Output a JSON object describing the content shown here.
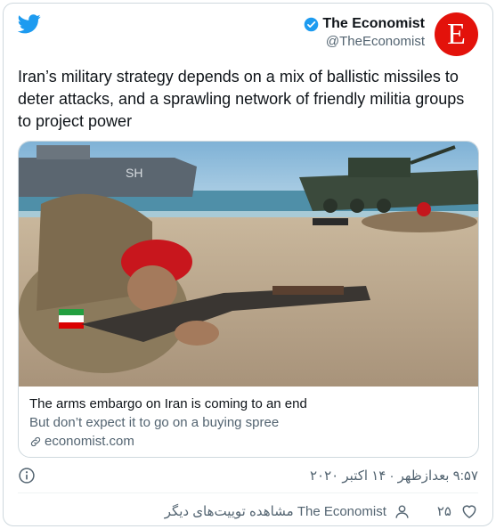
{
  "author": {
    "name": "The Economist",
    "handle": "@TheEconomist",
    "avatar_letter": "E",
    "verified": true
  },
  "tweet": {
    "text": "Iran’s military strategy depends on a mix of ballistic missiles to deter attacks, and a sprawling network of friendly militia groups to project power"
  },
  "link_card": {
    "image_label": "SH",
    "title": "The arms embargo on Iran is coming to an end",
    "description": "But don’t expect it to go on a buying spree",
    "domain": "economist.com"
  },
  "meta": {
    "timestamp": "۹:۵۷ بعدازظهر · ۱۴ اکتبر ۲۰۲۰"
  },
  "actions": {
    "like_count": "۲۵",
    "more_tweets_label": "مشاهده توییت‌های دیگر The Economist"
  },
  "colors": {
    "twitter_blue": "#1d9bf0",
    "economist_red": "#e3120b",
    "secondary_text": "#536471"
  }
}
